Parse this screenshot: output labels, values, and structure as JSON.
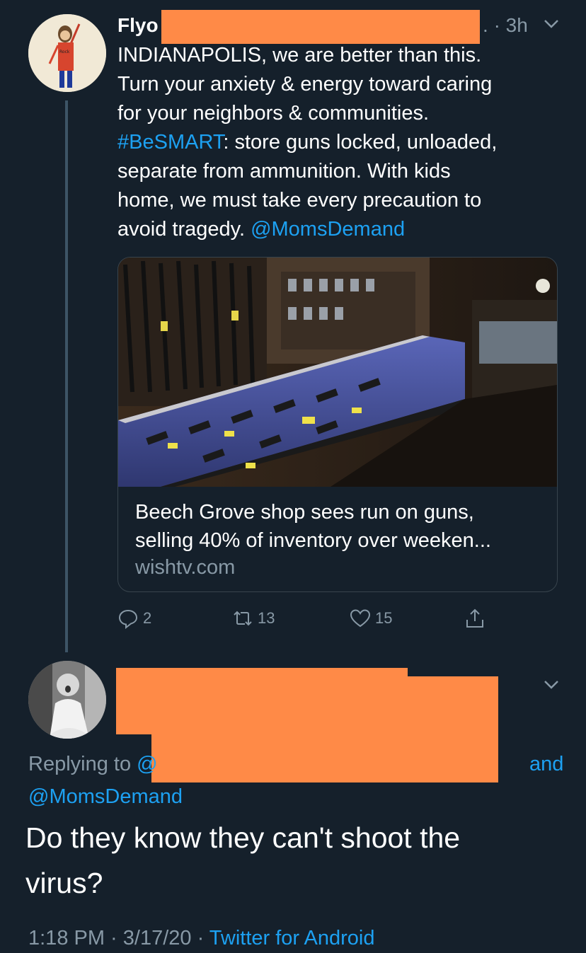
{
  "colors": {
    "background": "#15202b",
    "text": "#ffffff",
    "secondary_text": "#8899a6",
    "link": "#1da1f2",
    "redaction": "#ff8a47",
    "thread_line": "#3d5466"
  },
  "tweet": {
    "author_name_visible": "Flyo",
    "trailing_dot": ".",
    "time": "· 3h",
    "menu_icon": "chevron-down-icon",
    "text_lines": [
      "INDIANAPOLIS, we are better than this.",
      "Turn your anxiety & energy toward caring",
      "for your neighbors & communities."
    ],
    "hashtag": "#BeSMART",
    "text_after_hashtag": ": store guns locked, unloaded,",
    "text_lines_2": [
      "separate from ammunition. With kids",
      "home, we must take every precaution to"
    ],
    "text_before_mention": "avoid tragedy. ",
    "mention": "@MomsDemand",
    "card": {
      "title_line1": "Beech Grove shop sees run on guns,",
      "title_line2": "selling 40% of inventory over weeken...",
      "domain": "wishtv.com"
    },
    "actions": {
      "reply_count": "2",
      "retweet_count": "13",
      "like_count": "15",
      "icons": [
        "reply-icon",
        "retweet-icon",
        "heart-icon",
        "share-icon"
      ]
    }
  },
  "reply": {
    "menu_icon": "chevron-down-icon",
    "replying_prefix": "Replying to",
    "replying_partial": "@",
    "replying_and": "and",
    "replying_mention": "@MomsDemand",
    "text": "Do they know they can't shoot the virus?",
    "footer_time": "1:18 PM · 3/17/20 · ",
    "footer_source": "Twitter for Android"
  }
}
